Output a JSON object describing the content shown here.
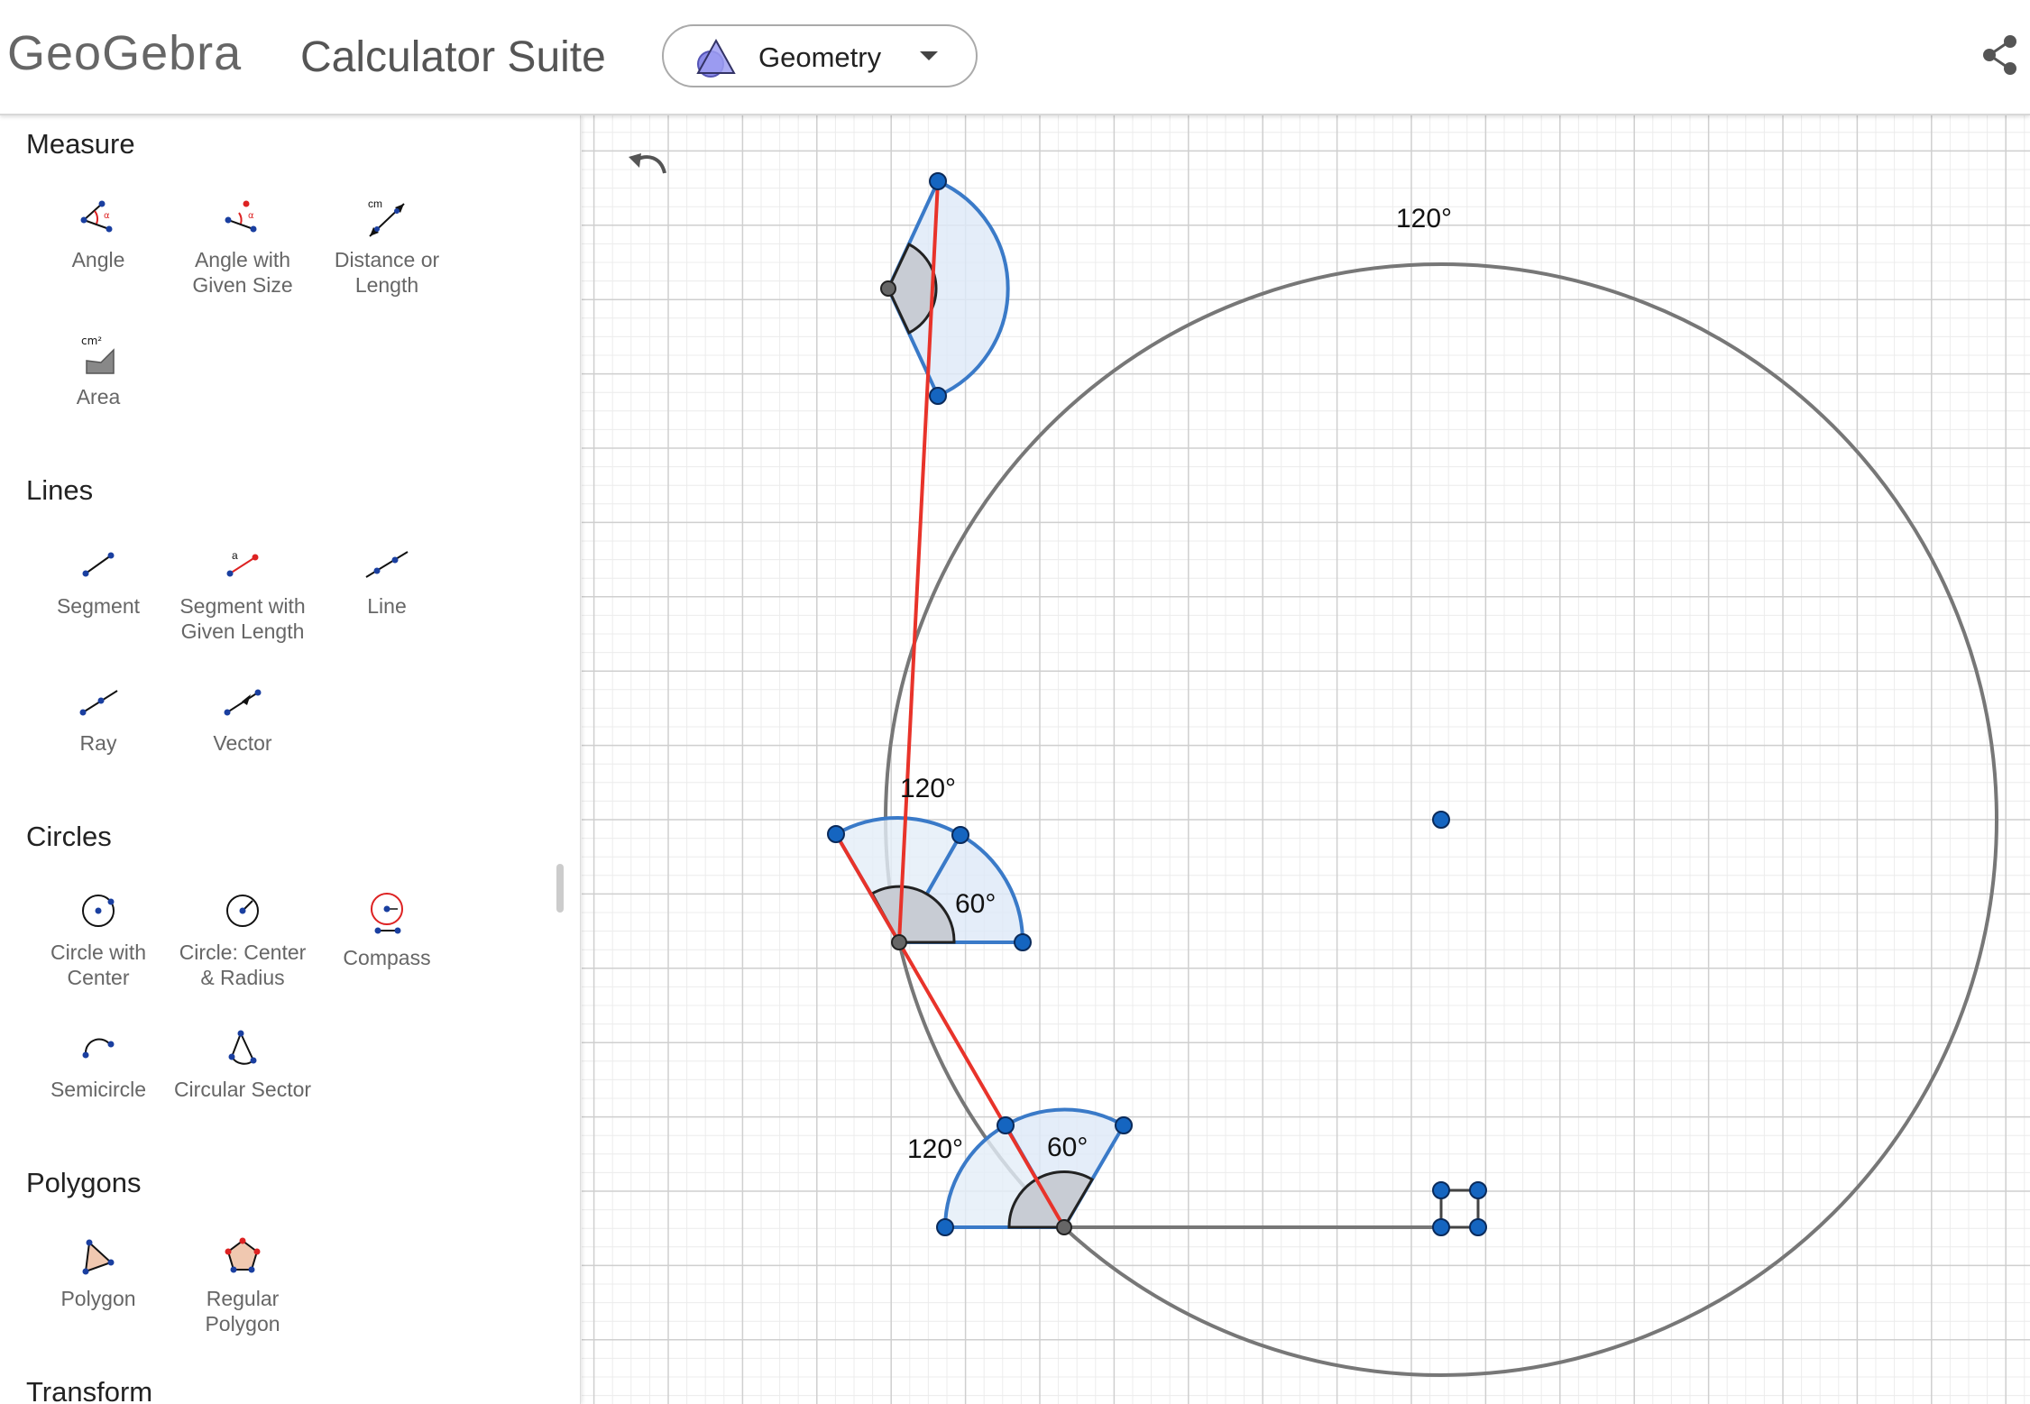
{
  "header": {
    "logo_text": "GeoGebra",
    "suite_title": "Calculator Suite",
    "app_select": {
      "label": "Geometry",
      "icon": "geometry-app-icon"
    },
    "share_icon": "share-icon"
  },
  "tool_panel": {
    "categories": [
      {
        "title": "Measure",
        "tools": [
          {
            "label": "Angle",
            "icon": "angle-icon"
          },
          {
            "label": "Angle with\nGiven Size",
            "icon": "angle-given-size-icon"
          },
          {
            "label": "Distance or\nLength",
            "icon": "distance-icon",
            "icon_text": "cm"
          },
          {
            "label": "Area",
            "icon": "area-icon",
            "icon_text": "cm²"
          }
        ]
      },
      {
        "title": "Lines",
        "tools": [
          {
            "label": "Segment",
            "icon": "segment-icon"
          },
          {
            "label": "Segment with\nGiven Length",
            "icon": "segment-given-length-icon",
            "icon_text": "a"
          },
          {
            "label": "Line",
            "icon": "line-icon"
          },
          {
            "label": "Ray",
            "icon": "ray-icon"
          },
          {
            "label": "Vector",
            "icon": "vector-icon"
          }
        ]
      },
      {
        "title": "Circles",
        "tools": [
          {
            "label": "Circle with\nCenter",
            "icon": "circle-center-icon"
          },
          {
            "label": "Circle: Center\n& Radius",
            "icon": "circle-radius-icon"
          },
          {
            "label": "Compass",
            "icon": "compass-icon"
          },
          {
            "label": "Semicircle",
            "icon": "semicircle-icon"
          },
          {
            "label": "Circular Sector",
            "icon": "circular-sector-icon"
          }
        ]
      },
      {
        "title": "Polygons",
        "tools": [
          {
            "label": "Polygon",
            "icon": "polygon-icon"
          },
          {
            "label": "Regular\nPolygon",
            "icon": "regular-polygon-icon"
          }
        ]
      },
      {
        "title": "Transform",
        "tools": []
      }
    ]
  },
  "canvas": {
    "undo_icon": "undo-icon",
    "angle_labels": {
      "top_120": "120°",
      "mid_120": "120°",
      "mid_60": "60°",
      "bottom_120": "120°",
      "bottom_60": "60°"
    },
    "colors": {
      "segment_red": "#e8332a",
      "protractor_blue": "#3a7ac8",
      "point_blue": "#1565c0",
      "circle_gray": "#777777",
      "grid_major": "#cfcfcf",
      "grid_minor": "#ececec"
    }
  }
}
